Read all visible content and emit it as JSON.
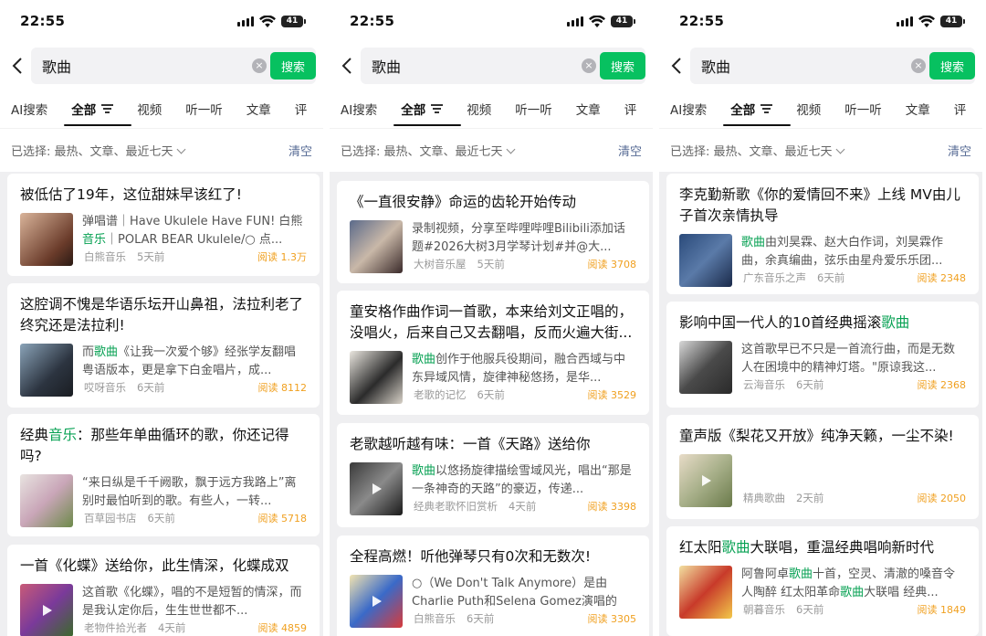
{
  "status": {
    "time": "22:55",
    "battery": "41"
  },
  "search": {
    "query": "歌曲",
    "button": "搜索"
  },
  "tabs": [
    "AI搜索",
    "全部",
    "视频",
    "听一听",
    "文章",
    "评"
  ],
  "filter": {
    "label": "已选择: 最热、文章、最近七天",
    "clear": "清空"
  },
  "colors": {
    "accent": "#07c160",
    "highlight": "#07a153",
    "reads": "#f0a020"
  },
  "screens": [
    {
      "cards": [
        {
          "title": "被低估了19年，这位甜妹早该红了!",
          "snippet": [
            "弹唱谱｜Have Ukulele Have FUN! 白熊",
            "音乐",
            "｜POLAR BEAR Ukulele/○ 点..."
          ],
          "source": "白熊音乐",
          "time": "5天前",
          "reads": "阅读 1.3万",
          "play": false
        },
        {
          "title": "这腔调不愧是华语乐坛开山鼻祖，法拉利老了终究还是法拉利!",
          "snippet": [
            "而",
            "歌曲",
            "《让我一次爱个够》经张学友翻唱粤语版本，更是拿下白金唱片，成..."
          ],
          "source": "哎呀音乐",
          "time": "6天前",
          "reads": "阅读 8112",
          "play": false
        },
        {
          "title_parts": [
            "经典",
            "音乐",
            "：那些年单曲循环的歌，你还记得吗?"
          ],
          "snippet": [
            "“来日纵是千千阙歌，飘于远方我路上”离别时最怕听到的歌。有些人，一转..."
          ],
          "source": "百草园书店",
          "time": "6天前",
          "reads": "阅读 5718",
          "play": false
        },
        {
          "title": "一首《化蝶》送给你，此生情深，化蝶成双",
          "snippet": [
            "这首歌《化蝶》，唱的不是短暂的情深，而是我认定你后，生生世世都不..."
          ],
          "source": "老物件拾光者",
          "time": "4天前",
          "reads": "阅读 4859",
          "play": true
        }
      ]
    },
    {
      "cards": [
        {
          "title": "《一直很安静》命运的齿轮开始传动",
          "snippet": [
            "录制视频，分享至哔哩哔哩Bilibili添加话题#2026大树3月学琴计划#并@大..."
          ],
          "source": "大树音乐屋",
          "time": "5天前",
          "reads": "阅读 3708",
          "play": false
        },
        {
          "title": "童安格作曲作词一首歌，本来给刘文正唱的，没唱火，后来自己又去翻唱，反而火遍大街...",
          "snippet": [
            "歌曲",
            "创作于他服兵役期间，融合西域与中东异域风情，旋律神秘悠扬，是华..."
          ],
          "source": "老歌的记忆",
          "time": "6天前",
          "reads": "阅读 3529",
          "play": false
        },
        {
          "title": "老歌越听越有味：一首《天路》送给你",
          "snippet": [
            "歌曲",
            "以悠扬旋律描绘雪域风光，唱出“那是一条神奇的天路”的豪迈，传递..."
          ],
          "source": "经典老歌怀旧赏析",
          "time": "4天前",
          "reads": "阅读 3398",
          "play": true
        },
        {
          "title": "全程高燃！听他弹琴只有0次和无数次!",
          "snippet": [
            "○（We Don't Talk Anymore）是由Charlie Puth和Selena Gomez演唱的一..."
          ],
          "source": "白熊音乐",
          "time": "6天前",
          "reads": "阅读 3305",
          "play": true
        }
      ]
    },
    {
      "cards": [
        {
          "title": "李克勤新歌《你的爱情回不来》上线 MV由儿子首次亲情执导",
          "snippet": [
            "歌曲",
            "由刘昊霖、赵大白作词，刘昊霖作曲，余真编曲，弦乐由星舟爱乐乐团..."
          ],
          "source": "广东音乐之声",
          "time": "6天前",
          "reads": "阅读 2348",
          "play": false
        },
        {
          "title_parts": [
            "影响中国一代人的10首经典摇滚",
            "歌曲",
            ""
          ],
          "snippet": [
            "这首歌早已不只是一首流行曲，而是无数人在困境中的精神灯塔。\"原谅我这..."
          ],
          "source": "云海音乐",
          "time": "6天前",
          "reads": "阅读 2368",
          "play": false
        },
        {
          "title": "童声版《梨花又开放》纯净天籁，一尘不染!",
          "snippet": [
            ""
          ],
          "source": "精典歌曲",
          "time": "2天前",
          "reads": "阅读 2050",
          "play": true
        },
        {
          "title_parts": [
            "红太阳",
            "歌曲",
            "大联唱，重温经典唱响新时代"
          ],
          "snippet": [
            "阿鲁阿卓",
            "歌曲",
            "十首，空灵、清澈的嗓音令人陶醉 红太阳革命",
            "歌曲",
            "大联唱 经典..."
          ],
          "source": "朝暮音乐",
          "time": "6天前",
          "reads": "阅读 1849",
          "play": false
        }
      ]
    }
  ]
}
